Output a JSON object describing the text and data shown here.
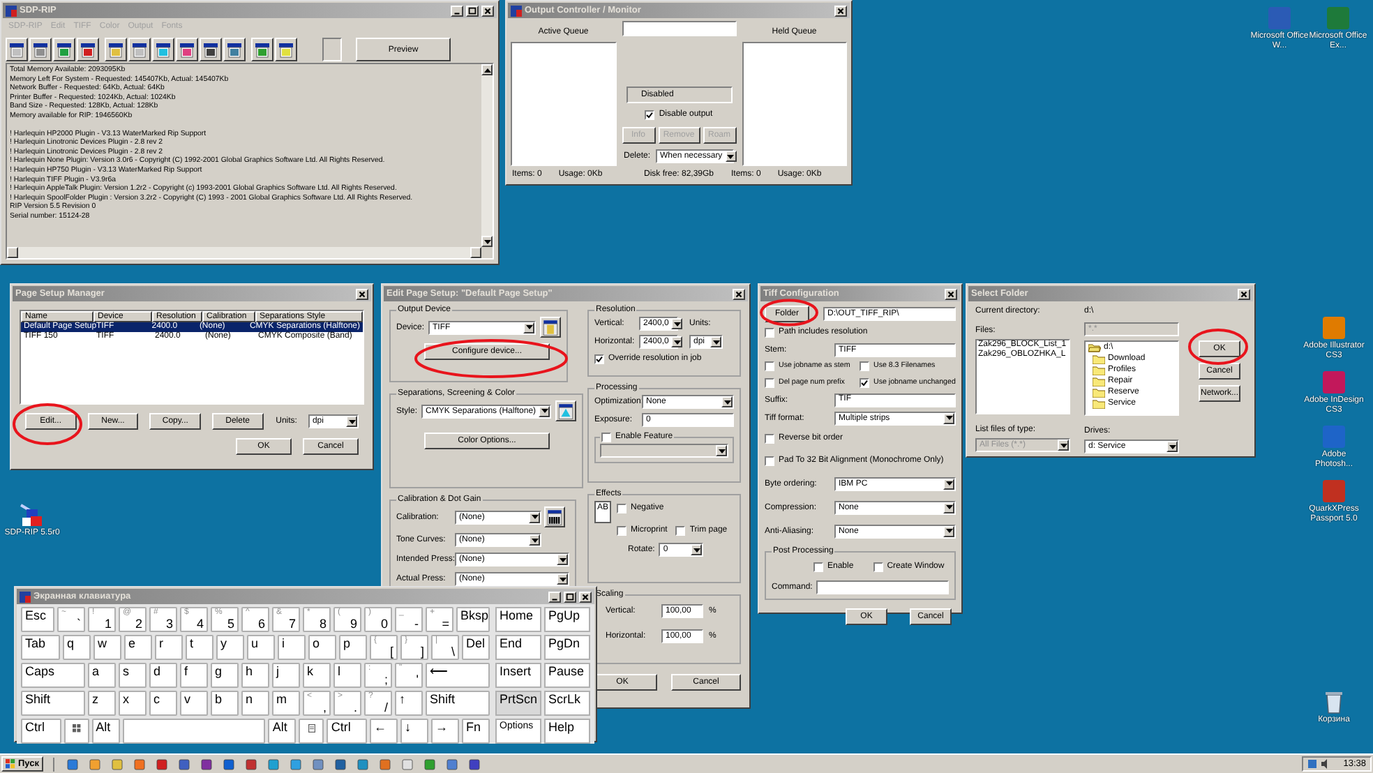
{
  "desktop": {
    "top_icons": [
      {
        "label": "Microsoft Office W...",
        "color": "#2b5bb5"
      },
      {
        "label": "Microsoft Office Ex...",
        "color": "#1e7a3a"
      }
    ],
    "right_icons": [
      {
        "label": "Adobe Illustrator CS3",
        "color": "#e07b00"
      },
      {
        "label": "Adobe InDesign CS3",
        "color": "#c2185b"
      },
      {
        "label": "Adobe Photosh...",
        "color": "#1e64c8"
      },
      {
        "label": "QuarkXPress Passport 5.0",
        "color": "#c03020"
      }
    ],
    "left_icon": {
      "label": "SDP-RIP 5.5r0"
    },
    "recycle_bin": {
      "label": "Корзина"
    }
  },
  "sdp_rip": {
    "title": "SDP-RIP",
    "menu": [
      {
        "label": "SDP-RIP",
        "disabled": true
      },
      {
        "label": "Edit",
        "disabled": true
      },
      {
        "label": "TIFF",
        "disabled": true
      },
      {
        "label": "Color",
        "disabled": true
      },
      {
        "label": "Output",
        "disabled": true
      },
      {
        "label": "Fonts",
        "disabled": true
      }
    ],
    "preview": "Preview",
    "log_blocks": [
      [
        "Total Memory Available: 2093095Kb",
        "Memory Left For System - Requested: 145407Kb, Actual: 145407Kb",
        "Network Buffer - Requested: 64Kb, Actual: 64Kb",
        "Printer Buffer - Requested: 1024Kb, Actual: 1024Kb",
        "Band Size - Requested: 128Kb, Actual: 128Kb",
        "Memory available for RIP: 1946560Kb"
      ],
      [
        "! Harlequin HP2000 Plugin - V3.13 WaterMarked Rip Support",
        "! Harlequin Linotronic Devices Plugin - 2.8 rev 2",
        "! Harlequin Linotronic Devices Plugin - 2.8 rev 2",
        "! Harlequin None Plugin: Version 3.0r6 - Copyright (C) 1992-2001 Global Graphics Software Ltd. All Rights Reserved.",
        "! Harlequin HP750 Plugin - V3.13 WaterMarked Rip Support",
        "! Harlequin TIFF Plugin - V3.9r6a",
        "! Harlequin AppleTalk Plugin: Version 1.2r2 - Copyright (c) 1993-2001 Global Graphics Software Ltd. All Rights Reserved.",
        "! Harlequin SpoolFolder Plugin : Version 3.2r2 - Copyright (C) 1993 - 2001 Global Graphics Software Ltd. All Rights Reserved.",
        "RIP Version 5.5 Revision 0",
        "Serial number: 15124-28"
      ]
    ]
  },
  "output_controller": {
    "title": "Output Controller / Monitor",
    "active_queue": "Active Queue",
    "held_queue": "Held Queue",
    "status": "Disabled",
    "disable_output": {
      "label": "Disable output",
      "checked": true
    },
    "buttons": [
      {
        "label": "Info",
        "disabled": true
      },
      {
        "label": "Remove",
        "disabled": true
      },
      {
        "label": "Roam",
        "disabled": true
      }
    ],
    "delete_label": "Delete:",
    "delete_value": "When necessary",
    "footer_left": [
      "Items: 0",
      "Usage: 0Kb"
    ],
    "disk_free": "Disk free: 82,39Gb",
    "footer_right": [
      "Items: 0",
      "Usage: 0Kb"
    ]
  },
  "page_setup_manager": {
    "title": "Page Setup Manager",
    "columns": [
      "Name",
      "Device",
      "Resolution",
      "Calibration",
      "Separations Style"
    ],
    "rows": [
      {
        "cells": [
          "Default Page Setup",
          "TIFF",
          "2400.0",
          "(None)",
          "CMYK Separations (Halftone)"
        ],
        "selected": true
      },
      {
        "cells": [
          "TIFF 150",
          "TIFF",
          "2400.0",
          "(None)",
          "CMYK Composite (Band)"
        ],
        "selected": false
      }
    ],
    "buttons": [
      "Edit...",
      "New...",
      "Copy...",
      "Delete"
    ],
    "units_label": "Units:",
    "units_value": "dpi",
    "ok": "OK",
    "cancel": "Cancel"
  },
  "edit_page_setup": {
    "title": "Edit Page Setup: \"Default Page Setup\"",
    "output_device": {
      "title": "Output Device",
      "device_label": "Device:",
      "device": "TIFF",
      "configure": "Configure device..."
    },
    "separations": {
      "title": "Separations, Screening & Color",
      "style_label": "Style:",
      "style": "CMYK Separations (Halftone)",
      "color_options": "Color Options..."
    },
    "calibration": {
      "title": "Calibration & Dot Gain",
      "rows": [
        {
          "label": "Calibration:",
          "value": "(None)"
        },
        {
          "label": "Tone Curves:",
          "value": "(None)"
        },
        {
          "label": "Intended Press:",
          "value": "(None)"
        },
        {
          "label": "Actual Press:",
          "value": "(None)"
        }
      ]
    },
    "resolution": {
      "title": "Resolution",
      "vertical_label": "Vertical:",
      "vertical": "2400,0",
      "horizontal_label": "Horizontal:",
      "horizontal": "2400,0",
      "units_label": "Units:",
      "units": "dpi",
      "override": {
        "label": "Override resolution in job",
        "checked": true
      }
    },
    "processing": {
      "title": "Processing",
      "optimization_label": "Optimization:",
      "optimization": "None",
      "exposure_label": "Exposure:",
      "exposure": "0",
      "enable_feature": {
        "label": "Enable Feature",
        "checked": false
      }
    },
    "effects": {
      "title": "Effects",
      "sample": "AB",
      "negative": {
        "label": "Negative",
        "checked": false
      },
      "microprint": {
        "label": "Microprint",
        "checked": false
      },
      "trim_page": {
        "label": "Trim page",
        "checked": false
      },
      "rotate_label": "Rotate:",
      "rotate": "0"
    },
    "scaling": {
      "title": "Scaling",
      "vertical_label": "Vertical:",
      "vertical": "100,00",
      "vertical_unit": "%",
      "horizontal_label": "Horizontal:",
      "horizontal": "100,00",
      "horizontal_unit": "%"
    },
    "ok": "OK",
    "cancel": "Cancel"
  },
  "tiff_configuration": {
    "title": "Tiff Configuration",
    "folder_button": "Folder",
    "path": "D:\\OUT_TIFF_RIP\\",
    "path_resolution": {
      "label": "Path includes resolution",
      "checked": false
    },
    "stem_label": "Stem:",
    "stem": "TIFF",
    "options": [
      {
        "label": "Use jobname as stem",
        "checked": false
      },
      {
        "label": "Use 8.3 Filenames",
        "checked": false
      },
      {
        "label": "Del page num prefix",
        "checked": false
      },
      {
        "label": "Use jobname unchanged",
        "checked": true
      }
    ],
    "suffix_label": "Suffix:",
    "suffix": "TIF",
    "format_label": "Tiff format:",
    "format": "Multiple strips",
    "checks": [
      {
        "label": "Reverse bit order",
        "checked": false
      },
      {
        "label": "Pad To 32 Bit Alignment (Monochrome Only)",
        "checked": false
      }
    ],
    "selects": [
      {
        "label": "Byte ordering:",
        "value": "IBM PC"
      },
      {
        "label": "Compression:",
        "value": "None"
      },
      {
        "label": "Anti-Aliasing:",
        "value": "None"
      }
    ],
    "post": {
      "title": "Post Processing",
      "enable": {
        "label": "Enable",
        "checked": false
      },
      "create_window": {
        "label": "Create Window",
        "checked": false
      },
      "command_label": "Command:"
    },
    "ok": "OK",
    "cancel": "Cancel"
  },
  "select_folder": {
    "title": "Select Folder",
    "current_label": "Current directory:",
    "current_value": "d:\\",
    "files_label": "Files:",
    "filter": "*.*",
    "files": [
      "Zak296_BLOCK_List_1",
      "Zak296_OBLOZHKA_L"
    ],
    "folders": [
      {
        "label": "d:\\",
        "open": true
      },
      {
        "label": "Download",
        "open": false
      },
      {
        "label": "Profiles",
        "open": false
      },
      {
        "label": "Repair",
        "open": false
      },
      {
        "label": "Reserve",
        "open": false
      },
      {
        "label": "Service",
        "open": false
      }
    ],
    "types_label": "List files of type:",
    "types_value": "All Files (*.*)",
    "drives_label": "Drives:",
    "drives_value": "d: Service",
    "buttons": [
      "OK",
      "Cancel",
      "Network..."
    ]
  },
  "keyboard": {
    "title": "Экранная клавиатура",
    "rows": [
      {
        "keys": [
          {
            "kind": "wide",
            "label": "Esc"
          },
          {
            "kind": "dual",
            "shift": "~",
            "label": "`"
          },
          {
            "kind": "dual",
            "shift": "!",
            "label": "1"
          },
          {
            "kind": "dual",
            "shift": "@",
            "label": "2"
          },
          {
            "kind": "dual",
            "shift": "#",
            "label": "3"
          },
          {
            "kind": "dual",
            "shift": "$",
            "label": "4"
          },
          {
            "kind": "dual",
            "shift": "%",
            "label": "5"
          },
          {
            "kind": "dual",
            "shift": "^",
            "label": "6"
          },
          {
            "kind": "dual",
            "shift": "&",
            "label": "7"
          },
          {
            "kind": "dual",
            "shift": "*",
            "label": "8"
          },
          {
            "kind": "dual",
            "shift": "(",
            "label": "9"
          },
          {
            "kind": "dual",
            "shift": ")",
            "label": "0"
          },
          {
            "kind": "dual",
            "shift": "_",
            "label": "-"
          },
          {
            "kind": "dual",
            "shift": "+",
            "label": "="
          },
          {
            "kind": "wide",
            "label": "Bksp"
          }
        ],
        "nav": [
          {
            "label": "Home",
            "pressed": false
          },
          {
            "label": "PgUp",
            "pressed": false
          }
        ]
      },
      {
        "keys": [
          {
            "kind": "wide",
            "label": "Tab"
          },
          {
            "kind": "key",
            "label": "q"
          },
          {
            "kind": "key",
            "label": "w"
          },
          {
            "kind": "key",
            "label": "e"
          },
          {
            "kind": "key",
            "label": "r"
          },
          {
            "kind": "key",
            "label": "t"
          },
          {
            "kind": "key",
            "label": "y"
          },
          {
            "kind": "key",
            "label": "u"
          },
          {
            "kind": "key",
            "label": "i"
          },
          {
            "kind": "key",
            "label": "o"
          },
          {
            "kind": "key",
            "label": "p"
          },
          {
            "kind": "dual",
            "shift": "{",
            "label": "["
          },
          {
            "kind": "dual",
            "shift": "}",
            "label": "]"
          },
          {
            "kind": "dual",
            "shift": "|",
            "label": "\\"
          },
          {
            "kind": "key",
            "label": "Del"
          }
        ],
        "nav": [
          {
            "label": "End",
            "pressed": false
          },
          {
            "label": "PgDn",
            "pressed": false
          }
        ]
      },
      {
        "keys": [
          {
            "kind": "wide",
            "label": "Caps"
          },
          {
            "kind": "key",
            "label": "a"
          },
          {
            "kind": "key",
            "label": "s"
          },
          {
            "kind": "key",
            "label": "d"
          },
          {
            "kind": "key",
            "label": "f"
          },
          {
            "kind": "key",
            "label": "g"
          },
          {
            "kind": "key",
            "label": "h"
          },
          {
            "kind": "key",
            "label": "j"
          },
          {
            "kind": "key",
            "label": "k"
          },
          {
            "kind": "key",
            "label": "l"
          },
          {
            "kind": "dual",
            "shift": ":",
            "label": ";"
          },
          {
            "kind": "dual",
            "shift": "\"",
            "label": "'"
          },
          {
            "kind": "wide",
            "label": "⟵"
          }
        ],
        "nav": [
          {
            "label": "Insert",
            "pressed": false
          },
          {
            "label": "Pause",
            "pressed": false
          }
        ]
      },
      {
        "keys": [
          {
            "kind": "wide",
            "label": "Shift"
          },
          {
            "kind": "key",
            "label": "z"
          },
          {
            "kind": "key",
            "label": "x"
          },
          {
            "kind": "key",
            "label": "c"
          },
          {
            "kind": "key",
            "label": "v"
          },
          {
            "kind": "key",
            "label": "b"
          },
          {
            "kind": "key",
            "label": "n"
          },
          {
            "kind": "key",
            "label": "m"
          },
          {
            "kind": "dual",
            "shift": "<",
            "label": ","
          },
          {
            "kind": "dual",
            "shift": ">",
            "label": "."
          },
          {
            "kind": "dual",
            "shift": "?",
            "label": "/"
          },
          {
            "kind": "key",
            "label": "↑"
          },
          {
            "kind": "wide",
            "label": "Shift"
          }
        ],
        "nav": [
          {
            "label": "PrtScn",
            "pressed": true
          },
          {
            "label": "ScrLk",
            "pressed": false
          }
        ]
      },
      {
        "keys": [
          {
            "kind": "wide",
            "label": "Ctrl"
          },
          {
            "kind": "windows"
          },
          {
            "kind": "key",
            "label": "Alt"
          },
          {
            "kind": "space"
          },
          {
            "kind": "key",
            "label": "Alt"
          },
          {
            "kind": "menu"
          },
          {
            "kind": "wide",
            "label": "Ctrl"
          },
          {
            "kind": "key",
            "label": "←"
          },
          {
            "kind": "key",
            "label": "↓"
          },
          {
            "kind": "key",
            "label": "→"
          },
          {
            "kind": "key",
            "label": "Fn"
          }
        ],
        "nav": [
          {
            "label": "Options",
            "pressed": false
          },
          {
            "label": "Help",
            "pressed": false
          }
        ]
      }
    ]
  },
  "taskbar": {
    "start": "Пуск",
    "clock": "13:38"
  }
}
